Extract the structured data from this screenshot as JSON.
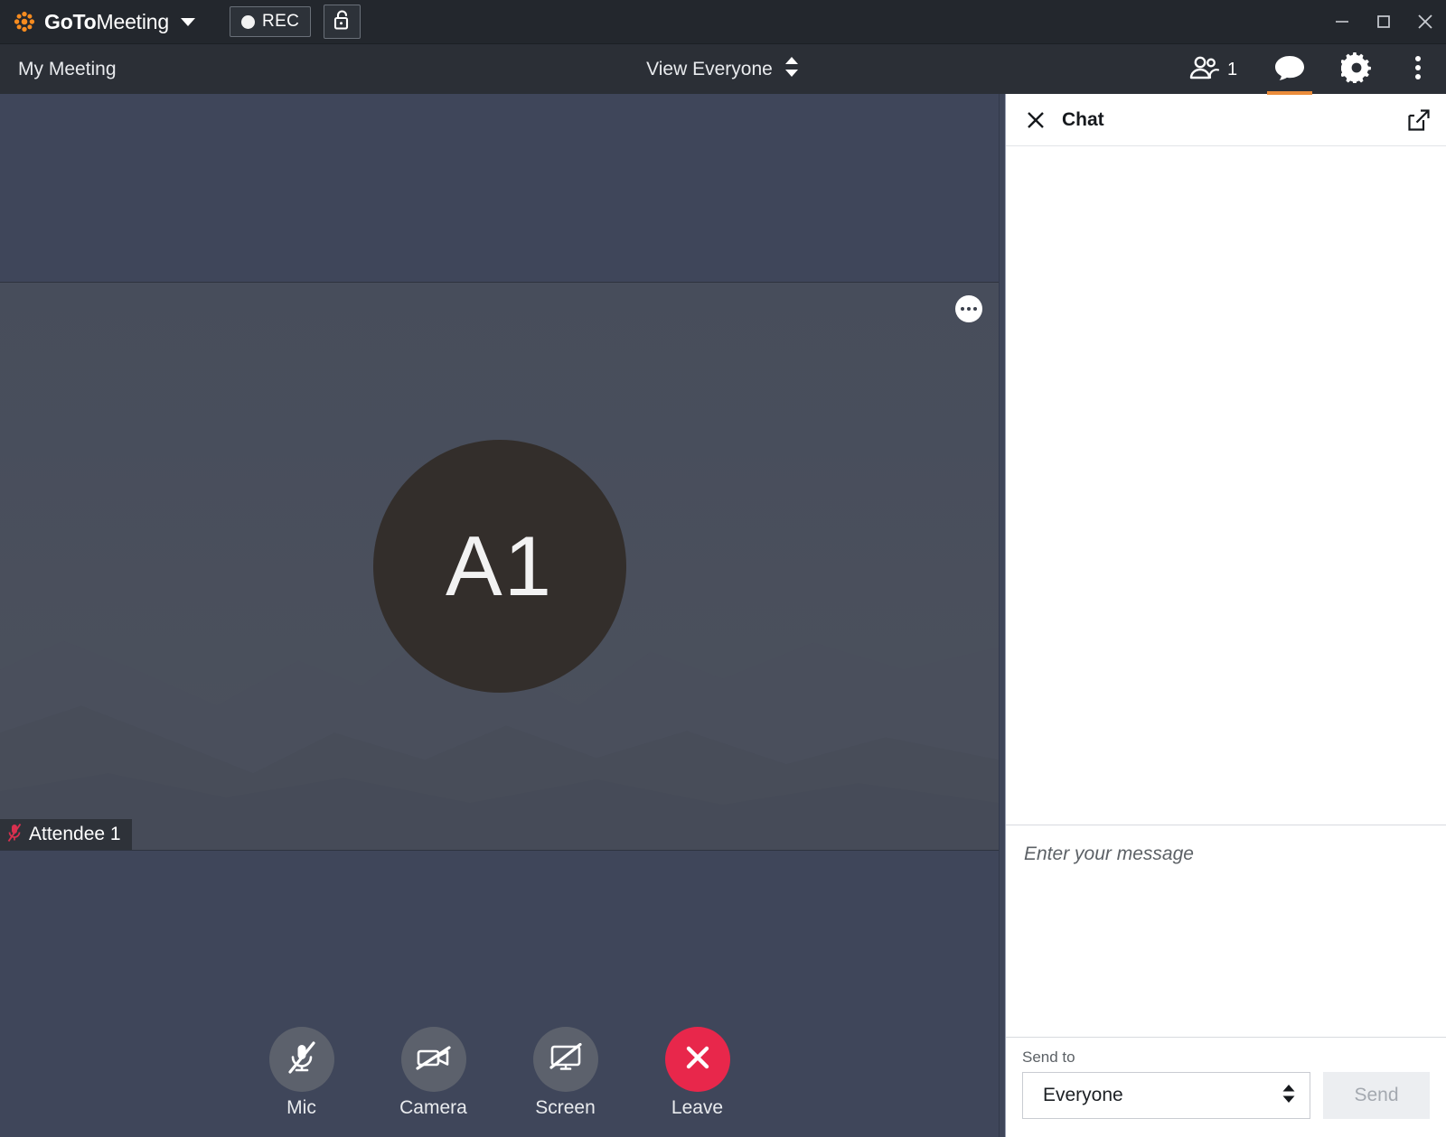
{
  "titlebar": {
    "brand_bold": "GoTo",
    "brand_thin": "Meeting",
    "brand_caret_icon": "chevron-down-icon",
    "logo_icon": "gotomeeting-asterisk-logo",
    "record_label": "REC",
    "record_icon": "record-dot-icon",
    "lock_icon": "unlocked-padlock-icon",
    "window_minimize_icon": "minimize-icon",
    "window_maximize_icon": "maximize-icon",
    "window_close_icon": "close-icon"
  },
  "menubar": {
    "meeting_title": "My Meeting",
    "view_label": "View Everyone",
    "view_spinner_icon": "up-down-chevron-icon",
    "people_icon": "people-icon",
    "people_count": "1",
    "chat_icon": "chat-bubble-icon",
    "chat_active": true,
    "settings_icon": "gear-icon",
    "overflow_icon": "vertical-dots-icon",
    "accent_color": "#eb8c3a"
  },
  "stage": {
    "tile": {
      "avatar_initials": "A1",
      "avatar_color": "#332e2b",
      "attendee_name": "Attendee 1",
      "muted_mic_icon": "mic-muted-icon",
      "muted_mic_color": "#d9304f",
      "more_icon": "three-dots-icon"
    },
    "controls": [
      {
        "label": "Mic",
        "icon": "mic-muted-icon",
        "state": "off",
        "color": "#5c616c"
      },
      {
        "label": "Camera",
        "icon": "camera-off-icon",
        "state": "off",
        "color": "#5c616c"
      },
      {
        "label": "Screen",
        "icon": "screen-off-icon",
        "state": "off",
        "color": "#5c616c"
      },
      {
        "label": "Leave",
        "icon": "close-x-icon",
        "state": "leave",
        "color": "#e8274b"
      }
    ]
  },
  "chat": {
    "close_icon": "close-icon",
    "title": "Chat",
    "popout_icon": "pop-out-icon",
    "messages": [],
    "message_placeholder": "Enter your message",
    "sendto_label": "Send to",
    "sendto_value": "Everyone",
    "sendto_spinner_icon": "up-down-chevron-icon",
    "send_label": "Send",
    "send_enabled": false
  }
}
